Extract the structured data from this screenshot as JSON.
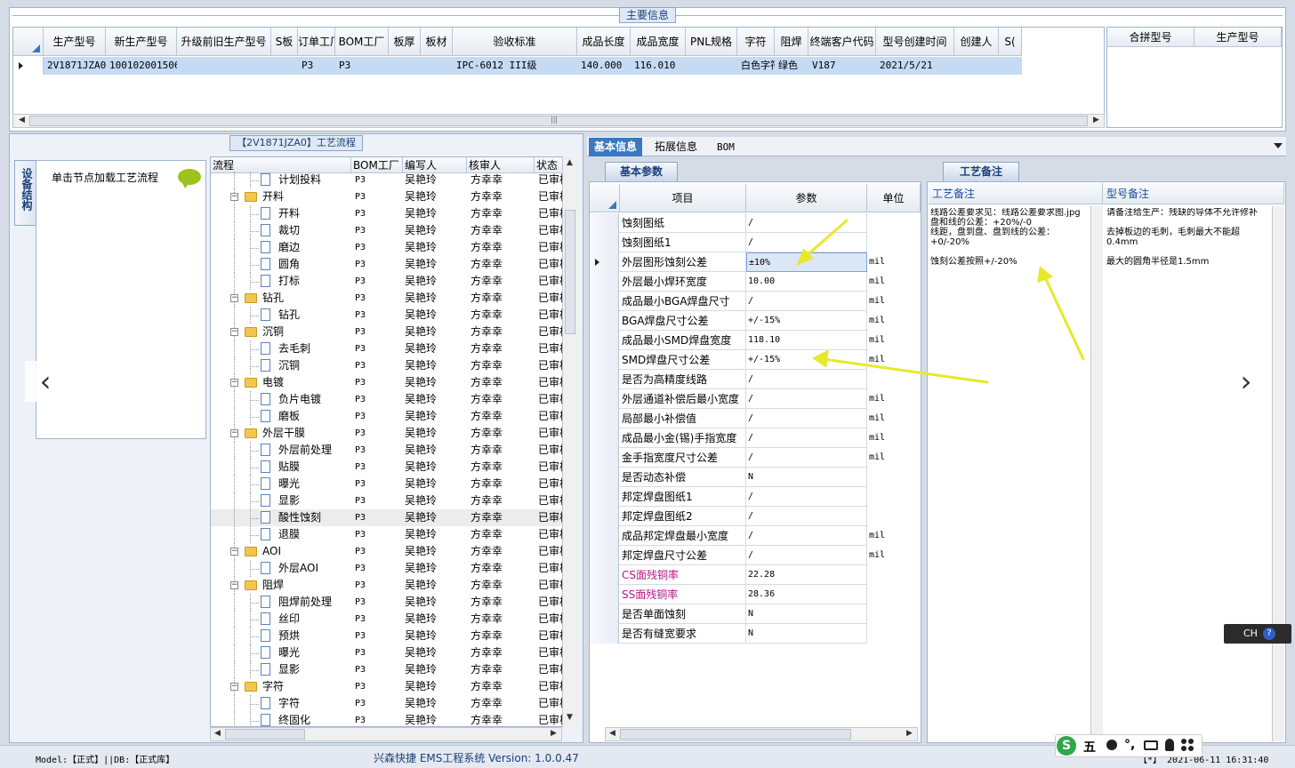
{
  "top": {
    "legend": "主要信息",
    "columns": [
      "生产型号",
      "新生产型号",
      "升级前旧生产型号",
      "S板",
      "订单工厂",
      "BOM工厂",
      "板厚",
      "板材",
      "验收标准",
      "成品长度",
      "成品宽度",
      "PNL规格",
      "字符",
      "阻焊",
      "终端客户代码",
      "型号创建时间",
      "创建人",
      "S("
    ],
    "row": [
      "2V1871JZA0",
      "10010200150693",
      "",
      "",
      "P3",
      "P3",
      "",
      "",
      "IPC-6012 III级",
      "140.000",
      "116.010",
      "",
      "白色字符",
      "绿色",
      "V187",
      "2021/5/21",
      "",
      ""
    ],
    "right_columns": [
      "合拼型号",
      "生产型号"
    ]
  },
  "process": {
    "title": "【2V1871JZA0】工艺流程",
    "side_tab": "设备结构",
    "load_hint": "单击节点加载工艺流程",
    "columns": [
      "流程",
      "BOM工厂",
      "编写人",
      "核审人",
      "状态"
    ],
    "rows": [
      {
        "name": "计划投料",
        "level": 2,
        "type": "file",
        "bom": "P3",
        "writer": "吴艳玲",
        "reviewer": "方幸幸",
        "status": "已审核"
      },
      {
        "name": "开料",
        "level": 1,
        "type": "folder",
        "bom": "P3",
        "writer": "吴艳玲",
        "reviewer": "方幸幸",
        "status": "已审核"
      },
      {
        "name": "开料",
        "level": 2,
        "type": "file",
        "bom": "P3",
        "writer": "吴艳玲",
        "reviewer": "方幸幸",
        "status": "已审核"
      },
      {
        "name": "裁切",
        "level": 2,
        "type": "file",
        "bom": "P3",
        "writer": "吴艳玲",
        "reviewer": "方幸幸",
        "status": "已审核"
      },
      {
        "name": "磨边",
        "level": 2,
        "type": "file",
        "bom": "P3",
        "writer": "吴艳玲",
        "reviewer": "方幸幸",
        "status": "已审核"
      },
      {
        "name": "圆角",
        "level": 2,
        "type": "file",
        "bom": "P3",
        "writer": "吴艳玲",
        "reviewer": "方幸幸",
        "status": "已审核"
      },
      {
        "name": "打标",
        "level": 2,
        "type": "file",
        "bom": "P3",
        "writer": "吴艳玲",
        "reviewer": "方幸幸",
        "status": "已审核"
      },
      {
        "name": "钻孔",
        "level": 1,
        "type": "folder",
        "bom": "P3",
        "writer": "吴艳玲",
        "reviewer": "方幸幸",
        "status": "已审核"
      },
      {
        "name": "钻孔",
        "level": 2,
        "type": "file",
        "bom": "P3",
        "writer": "吴艳玲",
        "reviewer": "方幸幸",
        "status": "已审核"
      },
      {
        "name": "沉铜",
        "level": 1,
        "type": "folder",
        "bom": "P3",
        "writer": "吴艳玲",
        "reviewer": "方幸幸",
        "status": "已审核"
      },
      {
        "name": "去毛刺",
        "level": 2,
        "type": "file",
        "bom": "P3",
        "writer": "吴艳玲",
        "reviewer": "方幸幸",
        "status": "已审核"
      },
      {
        "name": "沉铜",
        "level": 2,
        "type": "file",
        "bom": "P3",
        "writer": "吴艳玲",
        "reviewer": "方幸幸",
        "status": "已审核"
      },
      {
        "name": "电镀",
        "level": 1,
        "type": "folder",
        "bom": "P3",
        "writer": "吴艳玲",
        "reviewer": "方幸幸",
        "status": "已审核"
      },
      {
        "name": "负片电镀",
        "level": 2,
        "type": "file",
        "bom": "P3",
        "writer": "吴艳玲",
        "reviewer": "方幸幸",
        "status": "已审核"
      },
      {
        "name": "磨板",
        "level": 2,
        "type": "file",
        "bom": "P3",
        "writer": "吴艳玲",
        "reviewer": "方幸幸",
        "status": "已审核"
      },
      {
        "name": "外层干膜",
        "level": 1,
        "type": "folder",
        "bom": "P3",
        "writer": "吴艳玲",
        "reviewer": "方幸幸",
        "status": "已审核"
      },
      {
        "name": "外层前处理",
        "level": 2,
        "type": "file",
        "bom": "P3",
        "writer": "吴艳玲",
        "reviewer": "方幸幸",
        "status": "已审核"
      },
      {
        "name": "贴膜",
        "level": 2,
        "type": "file",
        "bom": "P3",
        "writer": "吴艳玲",
        "reviewer": "方幸幸",
        "status": "已审核"
      },
      {
        "name": "曝光",
        "level": 2,
        "type": "file",
        "bom": "P3",
        "writer": "吴艳玲",
        "reviewer": "方幸幸",
        "status": "已审核"
      },
      {
        "name": "显影",
        "level": 2,
        "type": "file",
        "bom": "P3",
        "writer": "吴艳玲",
        "reviewer": "方幸幸",
        "status": "已审核"
      },
      {
        "name": "酸性蚀刻",
        "level": 2,
        "type": "file",
        "bom": "P3",
        "writer": "吴艳玲",
        "reviewer": "方幸幸",
        "status": "已审核",
        "selected": true
      },
      {
        "name": "退膜",
        "level": 2,
        "type": "file",
        "bom": "P3",
        "writer": "吴艳玲",
        "reviewer": "方幸幸",
        "status": "已审核"
      },
      {
        "name": "AOI",
        "level": 1,
        "type": "folder",
        "bom": "P3",
        "writer": "吴艳玲",
        "reviewer": "方幸幸",
        "status": "已审核"
      },
      {
        "name": "外层AOI",
        "level": 2,
        "type": "file",
        "bom": "P3",
        "writer": "吴艳玲",
        "reviewer": "方幸幸",
        "status": "已审核"
      },
      {
        "name": "阻焊",
        "level": 1,
        "type": "folder",
        "bom": "P3",
        "writer": "吴艳玲",
        "reviewer": "方幸幸",
        "status": "已审核"
      },
      {
        "name": "阻焊前处理",
        "level": 2,
        "type": "file",
        "bom": "P3",
        "writer": "吴艳玲",
        "reviewer": "方幸幸",
        "status": "已审核"
      },
      {
        "name": "丝印",
        "level": 2,
        "type": "file",
        "bom": "P3",
        "writer": "吴艳玲",
        "reviewer": "方幸幸",
        "status": "已审核"
      },
      {
        "name": "预烘",
        "level": 2,
        "type": "file",
        "bom": "P3",
        "writer": "吴艳玲",
        "reviewer": "方幸幸",
        "status": "已审核"
      },
      {
        "name": "曝光",
        "level": 2,
        "type": "file",
        "bom": "P3",
        "writer": "吴艳玲",
        "reviewer": "方幸幸",
        "status": "已审核"
      },
      {
        "name": "显影",
        "level": 2,
        "type": "file",
        "bom": "P3",
        "writer": "吴艳玲",
        "reviewer": "方幸幸",
        "status": "已审核"
      },
      {
        "name": "字符",
        "level": 1,
        "type": "folder",
        "bom": "P3",
        "writer": "吴艳玲",
        "reviewer": "方幸幸",
        "status": "已审核"
      },
      {
        "name": "字符",
        "level": 2,
        "type": "file",
        "bom": "P3",
        "writer": "吴艳玲",
        "reviewer": "方幸幸",
        "status": "已审核"
      },
      {
        "name": "终固化",
        "level": 2,
        "type": "file",
        "bom": "P3",
        "writer": "吴艳玲",
        "reviewer": "方幸幸",
        "status": "已审核"
      }
    ]
  },
  "tabs": [
    "基本信息",
    "拓展信息",
    "BOM"
  ],
  "params": {
    "title": "基本参数",
    "columns": [
      "项目",
      "参数",
      "单位"
    ],
    "rows": [
      {
        "item": "蚀刻图纸",
        "value": "/",
        "unit": ""
      },
      {
        "item": "蚀刻图纸1",
        "value": "/",
        "unit": ""
      },
      {
        "item": "外层图形蚀刻公差",
        "value": "±10%",
        "unit": "mil",
        "current": true
      },
      {
        "item": "外层最小焊环宽度",
        "value": "10.00",
        "unit": "mil"
      },
      {
        "item": "成品最小BGA焊盘尺寸",
        "value": "/",
        "unit": "mil"
      },
      {
        "item": "BGA焊盘尺寸公差",
        "value": "+/-15%",
        "unit": "mil"
      },
      {
        "item": "成品最小SMD焊盘宽度",
        "value": "118.10",
        "unit": "mil"
      },
      {
        "item": "SMD焊盘尺寸公差",
        "value": "+/-15%",
        "unit": "mil"
      },
      {
        "item": "是否为高精度线路",
        "value": "/",
        "unit": ""
      },
      {
        "item": "外层通道补偿后最小宽度",
        "value": "/",
        "unit": "mil"
      },
      {
        "item": "局部最小补偿值",
        "value": "/",
        "unit": "mil"
      },
      {
        "item": "成品最小金(锡)手指宽度",
        "value": "/",
        "unit": "mil"
      },
      {
        "item": "金手指宽度尺寸公差",
        "value": "/",
        "unit": "mil"
      },
      {
        "item": "是否动态补偿",
        "value": "N",
        "unit": ""
      },
      {
        "item": "邦定焊盘图纸1",
        "value": "/",
        "unit": ""
      },
      {
        "item": "邦定焊盘图纸2",
        "value": "/",
        "unit": ""
      },
      {
        "item": "成品邦定焊盘最小宽度",
        "value": "/",
        "unit": "mil"
      },
      {
        "item": "邦定焊盘尺寸公差",
        "value": "/",
        "unit": "mil"
      },
      {
        "item": "CS面残铜率",
        "value": "22.28",
        "unit": "",
        "magenta": true
      },
      {
        "item": "SS面残铜率",
        "value": "28.36",
        "unit": "",
        "magenta": true
      },
      {
        "item": "是否单面蚀刻",
        "value": "N",
        "unit": ""
      },
      {
        "item": "是否有缝宽要求",
        "value": "N",
        "unit": ""
      }
    ]
  },
  "notes": {
    "title": "工艺备注",
    "col1_title": "工艺备注",
    "col2_title": "型号备注",
    "col1_text": "线路公差要求见：线路公差要求图.jpg\n盘和线的公差：+20%/-0\n线距，盘到盘、盘到线的公差：+0/-20%\n\n蚀刻公差按照+/-20%",
    "col2_text": "请备注给生产：残缺的导体不允许修补\n\n去掉板边的毛刺，毛刺最大不能超0.4mm\n\n最大的圆角半径是1.5mm"
  },
  "status": {
    "model": "Model:【正式】||DB:【正式库】",
    "title": "兴森快捷 EMS工程系统 Version: 1.0.0.47",
    "time": "【*】 2021-06-11 16:31:40"
  },
  "ime": {
    "lang": "CH",
    "sogou_char": "五"
  },
  "colors": {
    "accent": "#3a78c0",
    "selection": "#c5daf3",
    "annotation_arrow": "#e8e82a",
    "magenta_label": "#b0178a"
  }
}
